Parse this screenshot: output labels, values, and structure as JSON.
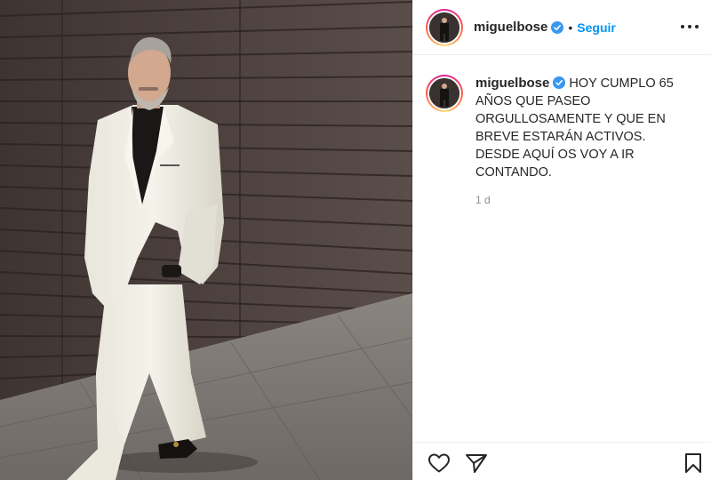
{
  "post": {
    "photo_alt": "",
    "icon_photo": "post-photo"
  },
  "header": {
    "username": "miguelbose",
    "separator": "•",
    "follow_label": "Seguir",
    "icons": [
      "avatar",
      "verified-badge-icon",
      "more-options-icon"
    ]
  },
  "caption": {
    "username": "miguelbose",
    "text": "HOY CUMPLO 65 AÑOS QUE PASEO ORGULLOSAMENTE Y QUE EN BREVE ESTARÁN ACTIVOS. DESDE AQUÍ OS VOY A IR CONTANDO.",
    "timestamp": "1 d"
  },
  "actions": {
    "icons": [
      "heart-icon",
      "share-icon",
      "bookmark-icon"
    ]
  },
  "colors": {
    "link_blue": "#0095f6",
    "verified_blue": "#3897f0",
    "text": "#262626",
    "muted": "#8e8e8e"
  }
}
